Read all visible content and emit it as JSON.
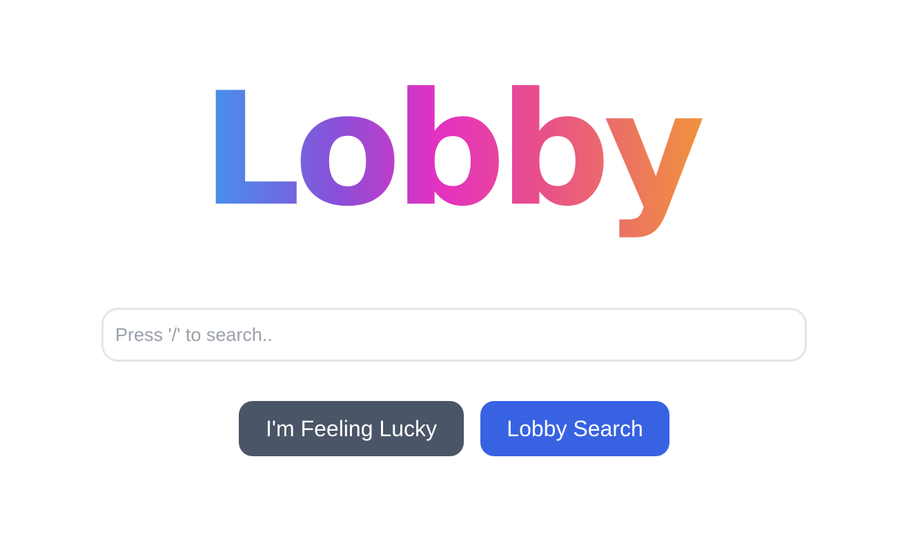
{
  "logo": {
    "text": "Lobby",
    "gradient_colors": [
      "#3d9bee",
      "#8a4fd8",
      "#e431c0",
      "#e8508a",
      "#f0953a"
    ]
  },
  "search": {
    "placeholder": "Press '/' to search..",
    "value": ""
  },
  "buttons": {
    "lucky_label": "I'm Feeling Lucky",
    "search_label": "Lobby Search"
  },
  "colors": {
    "background": "#ffffff",
    "lucky_button": "#4a5567",
    "search_button": "#3762e2",
    "input_border": "#e5e5e5",
    "placeholder": "#9aa0aa"
  }
}
